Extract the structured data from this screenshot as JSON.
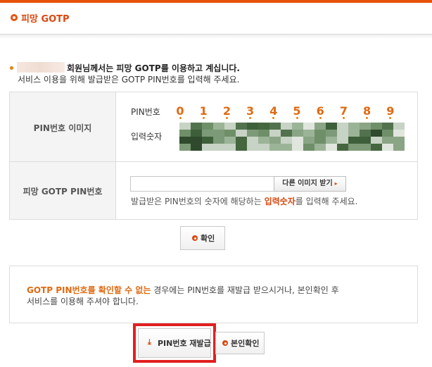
{
  "header": {
    "title": "피망 GOTP",
    "icon": "orange-circle-icon"
  },
  "notice": {
    "line1": "회원님께서는 피망 GOTP를 이용하고 계십니다.",
    "line2": "서비스 이용을 위해 발급받은 GOTP PIN번호를 입력해 주세요."
  },
  "pin_image_row": {
    "label": "PIN번호 이미지",
    "pin_label": "PIN번호",
    "digits": [
      "0",
      "1",
      "2",
      "3",
      "4",
      "5",
      "6",
      "7",
      "8",
      "9"
    ],
    "input_digits_label": "입력숫자"
  },
  "pin_input_row": {
    "label": "피망 GOTP PIN번호",
    "input_value": "",
    "other_image_button": "다른 이미지 받기",
    "hint_prefix": "발급받은 PIN번호의 숫자에 해당하는 ",
    "hint_emphasis": "입력숫자",
    "hint_suffix": "를 입력해 주세요."
  },
  "confirm_button": "확인",
  "info": {
    "emphasis": "GOTP PIN번호를 확인할 수 없는",
    "text1_rest": " 경우에는 PIN번호를 재발급 받으시거나, 본인확인 후",
    "text2": "서비스를 이용해 주셔야 합니다."
  },
  "reissue_button": "PIN번호 재발급",
  "identity_button": "본인확인",
  "colors": {
    "accent": "#e8520a",
    "digit": "#e06a12",
    "highlight": "#e12020"
  }
}
